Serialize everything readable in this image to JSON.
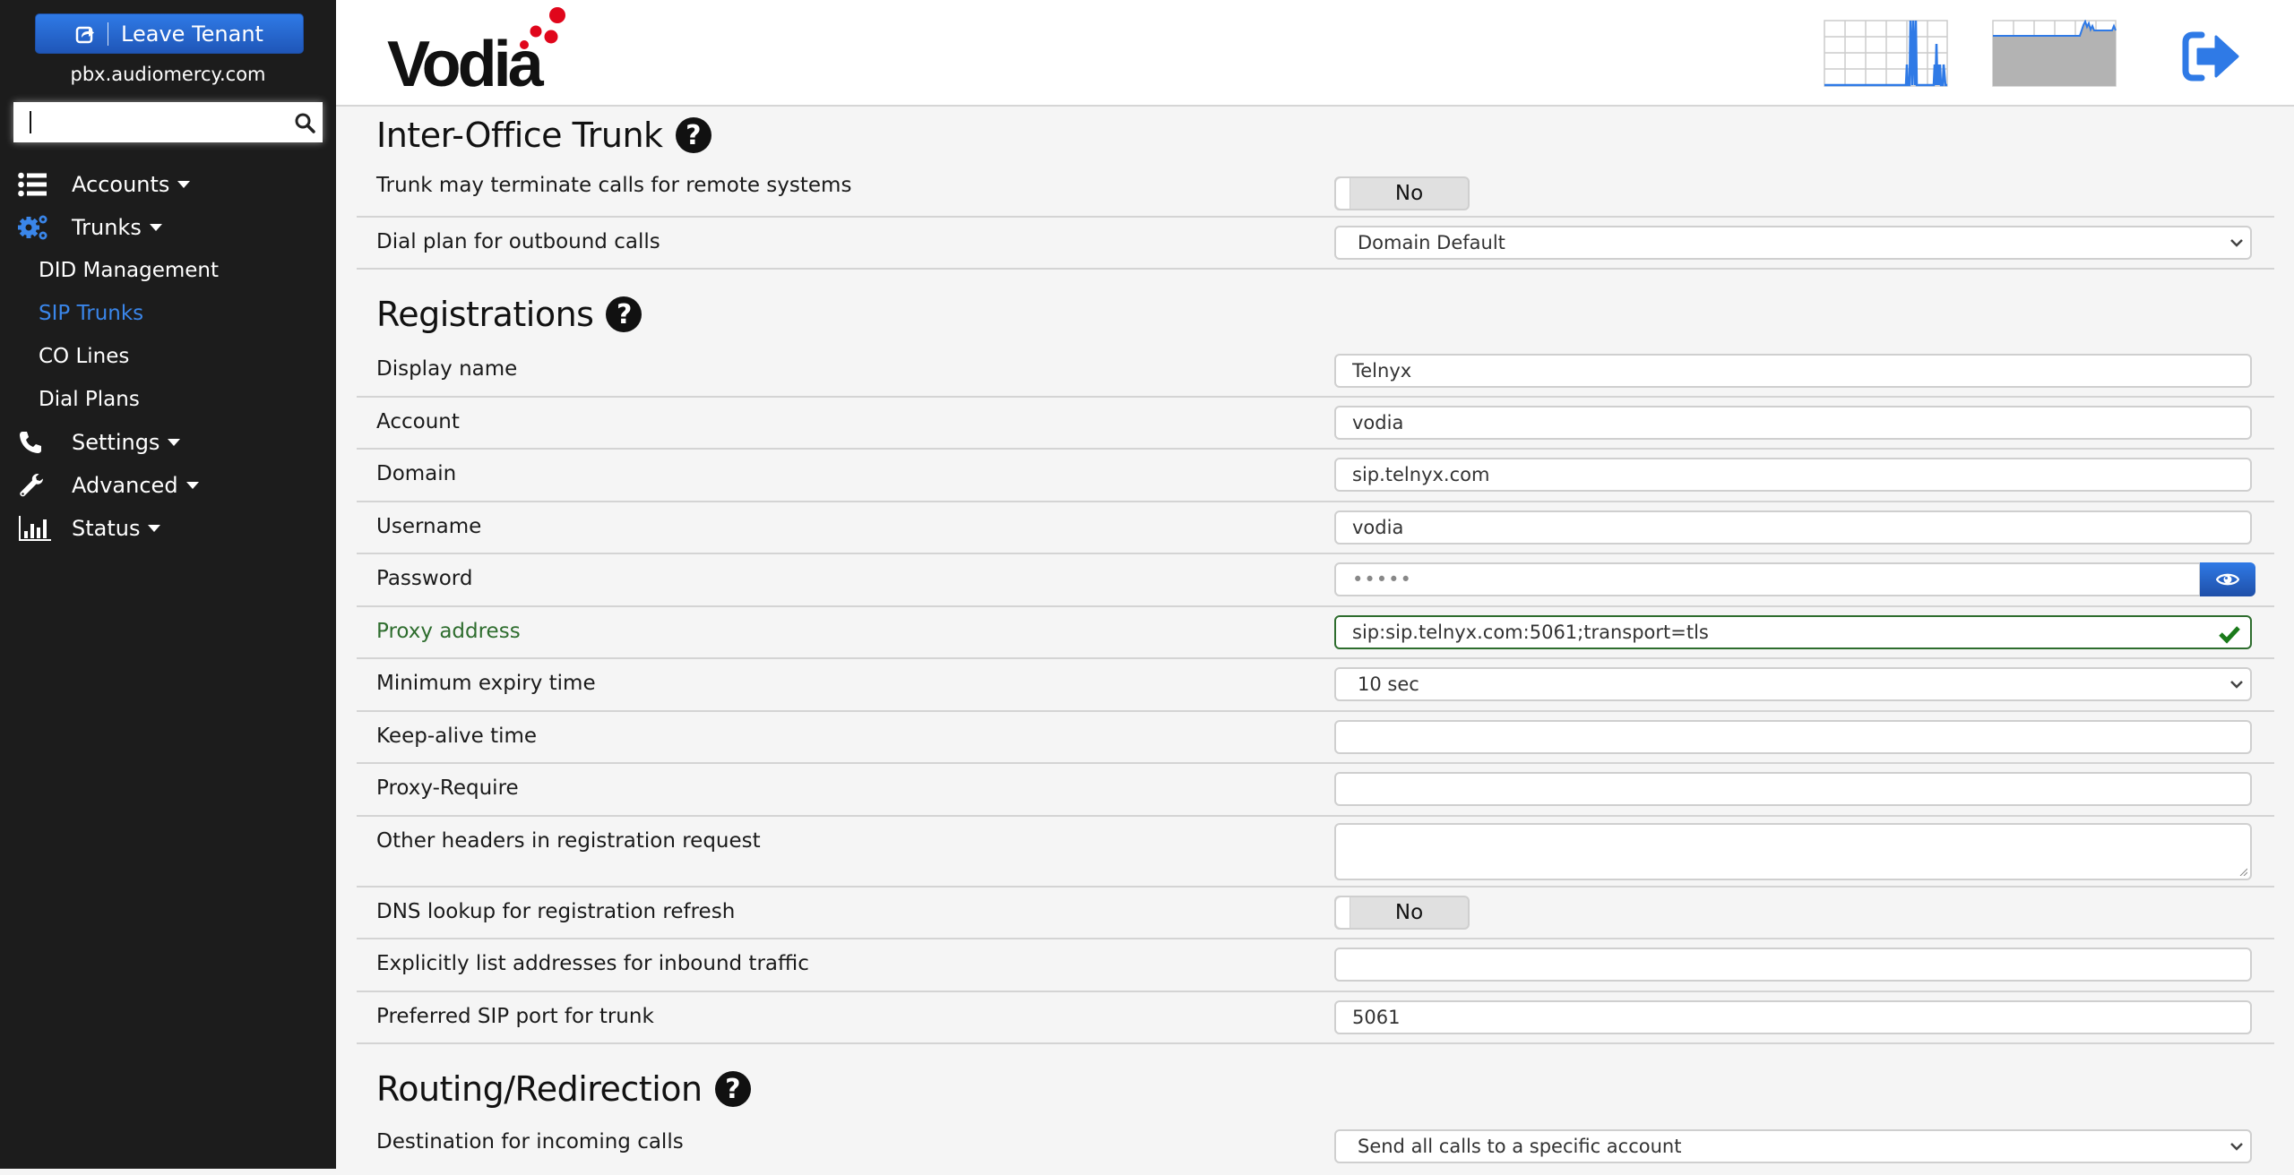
{
  "sidebar": {
    "leave_tenant_label": "Leave Tenant",
    "domain": "pbx.audiomercy.com",
    "search": {
      "value": "",
      "placeholder": ""
    },
    "nav": [
      {
        "label": "Accounts",
        "icon": "list-icon"
      },
      {
        "label": "Trunks",
        "icon": "gears-icon",
        "expanded": true,
        "children": [
          {
            "label": "DID Management",
            "active": false
          },
          {
            "label": "SIP Trunks",
            "active": true
          },
          {
            "label": "CO Lines",
            "active": false
          },
          {
            "label": "Dial Plans",
            "active": false
          }
        ]
      },
      {
        "label": "Settings",
        "icon": "phone-icon"
      },
      {
        "label": "Advanced",
        "icon": "wrench-icon"
      },
      {
        "label": "Status",
        "icon": "bar-chart-icon"
      }
    ]
  },
  "header": {
    "logo_text": "Vodia",
    "colors": {
      "accent": "#2f7ae6",
      "logo_dots": "#e0061b",
      "valid": "#2e6d2e"
    }
  },
  "sections": {
    "inter_office": {
      "title": "Inter-Office Trunk",
      "rows": {
        "terminate_remote": {
          "label": "Trunk may terminate calls for remote systems",
          "value": "No"
        },
        "dial_plan": {
          "label": "Dial plan for outbound calls",
          "value": "Domain Default"
        }
      }
    },
    "registrations": {
      "title": "Registrations",
      "rows": {
        "display_name": {
          "label": "Display name",
          "value": "Telnyx"
        },
        "account": {
          "label": "Account",
          "value": "vodia"
        },
        "domain": {
          "label": "Domain",
          "value": "sip.telnyx.com"
        },
        "username": {
          "label": "Username",
          "value": "vodia"
        },
        "password": {
          "label": "Password",
          "value": "•••••"
        },
        "proxy_address": {
          "label": "Proxy address",
          "value": "sip:sip.telnyx.com:5061;transport=tls"
        },
        "min_expiry": {
          "label": "Minimum expiry time",
          "value": "10 sec"
        },
        "keep_alive": {
          "label": "Keep-alive time",
          "value": ""
        },
        "proxy_require": {
          "label": "Proxy-Require",
          "value": ""
        },
        "other_headers": {
          "label": "Other headers in registration request",
          "value": ""
        },
        "dns_lookup": {
          "label": "DNS lookup for registration refresh",
          "value": "No"
        },
        "explicit_addresses": {
          "label": "Explicitly list addresses for inbound traffic",
          "value": ""
        },
        "preferred_port": {
          "label": "Preferred SIP port for trunk",
          "value": "5061"
        }
      }
    },
    "routing": {
      "title": "Routing/Redirection",
      "rows": {
        "incoming_destination": {
          "label": "Destination for incoming calls",
          "value": "Send all calls to a specific account"
        }
      }
    }
  }
}
